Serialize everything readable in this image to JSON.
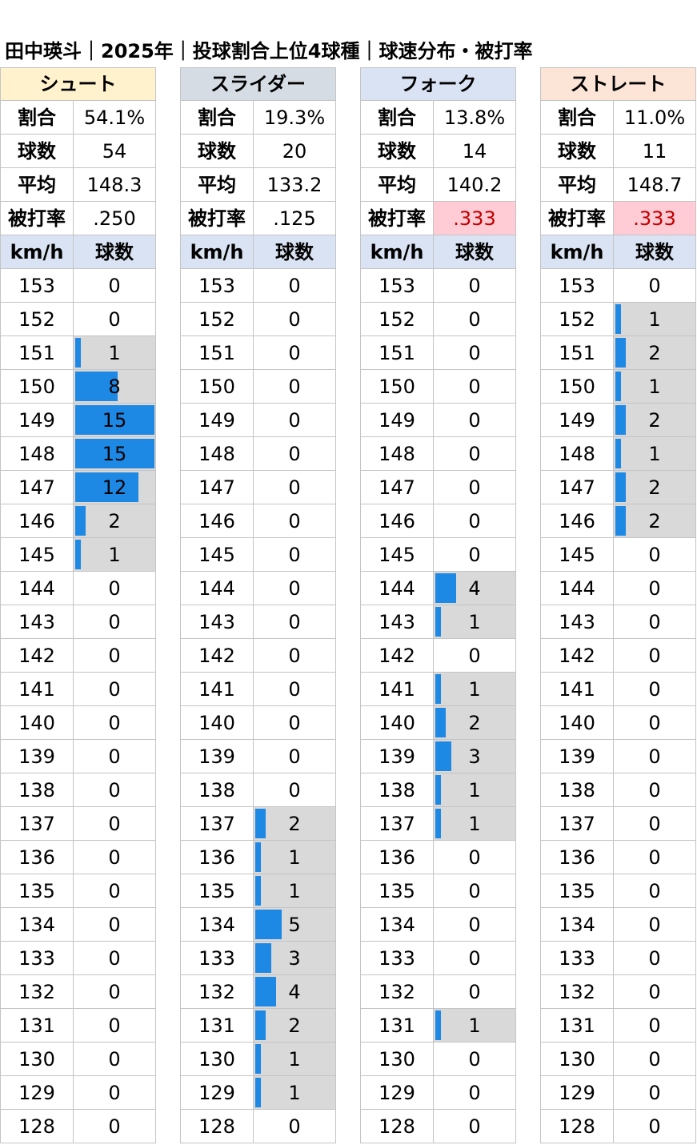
{
  "title": "田中瑛斗｜2025年｜投球割合上位4球種｜球速分布・被打率",
  "labels": {
    "ratio": "割合",
    "count": "球数",
    "avg": "平均",
    "ba": "被打率",
    "speed_header": "km/h",
    "count_header": "球数"
  },
  "colors": {
    "bar": "#1e88e5",
    "count_cell_bg": "#d9d9d9",
    "subheader_bg": "#dae3f3",
    "highlight_bg": "#ffccd5",
    "highlight_text": "#c00000"
  },
  "chart_data": {
    "type": "table",
    "speeds": [
      153,
      152,
      151,
      150,
      149,
      148,
      147,
      146,
      145,
      144,
      143,
      142,
      141,
      140,
      139,
      138,
      137,
      136,
      135,
      134,
      133,
      132,
      131,
      130,
      129,
      128
    ],
    "x_unit": "km/h",
    "bar_max": 15,
    "pitches": [
      {
        "name": "シュート",
        "header_color": "#fff2cc",
        "ratio": "54.1%",
        "count": "54",
        "avg": "148.3",
        "ba": ".250",
        "ba_highlight": false,
        "counts": [
          0,
          0,
          1,
          8,
          15,
          15,
          12,
          2,
          1,
          0,
          0,
          0,
          0,
          0,
          0,
          0,
          0,
          0,
          0,
          0,
          0,
          0,
          0,
          0,
          0,
          0
        ]
      },
      {
        "name": "スライダー",
        "header_color": "#d6dce4",
        "ratio": "19.3%",
        "count": "20",
        "avg": "133.2",
        "ba": ".125",
        "ba_highlight": false,
        "counts": [
          0,
          0,
          0,
          0,
          0,
          0,
          0,
          0,
          0,
          0,
          0,
          0,
          0,
          0,
          0,
          0,
          2,
          1,
          1,
          5,
          3,
          4,
          2,
          1,
          1,
          0
        ]
      },
      {
        "name": "フォーク",
        "header_color": "#dae3f3",
        "ratio": "13.8%",
        "count": "14",
        "avg": "140.2",
        "ba": ".333",
        "ba_highlight": true,
        "counts": [
          0,
          0,
          0,
          0,
          0,
          0,
          0,
          0,
          0,
          4,
          1,
          0,
          1,
          2,
          3,
          1,
          1,
          0,
          0,
          0,
          0,
          0,
          1,
          0,
          0,
          0
        ]
      },
      {
        "name": "ストレート",
        "header_color": "#fce4d6",
        "ratio": "11.0%",
        "count": "11",
        "avg": "148.7",
        "ba": ".333",
        "ba_highlight": true,
        "counts": [
          0,
          1,
          2,
          1,
          2,
          1,
          2,
          2,
          0,
          0,
          0,
          0,
          0,
          0,
          0,
          0,
          0,
          0,
          0,
          0,
          0,
          0,
          0,
          0,
          0,
          0
        ]
      }
    ]
  }
}
